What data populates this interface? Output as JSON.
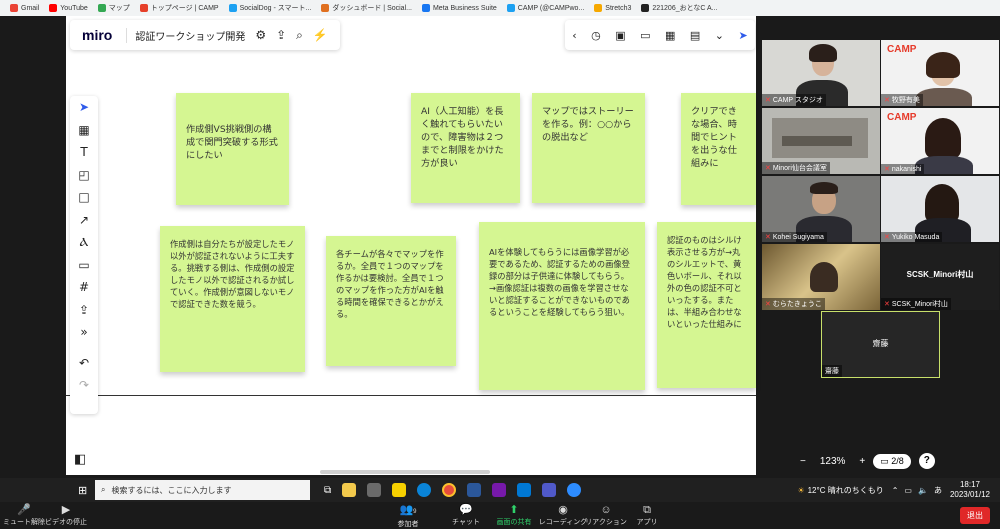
{
  "bookmarks": [
    {
      "label": "Gmail",
      "color": "#ea4335"
    },
    {
      "label": "YouTube",
      "color": "#ff0000"
    },
    {
      "label": "マップ",
      "color": "#34a853"
    },
    {
      "label": "トップページ | CAMP",
      "color": "#e6402a"
    },
    {
      "label": "SocialDog - スマート...",
      "color": "#1da1f2"
    },
    {
      "label": "ダッシュボード | Social...",
      "color": "#e07020"
    },
    {
      "label": "Meta Business Suite",
      "color": "#1877f2"
    },
    {
      "label": "CAMP (@CAMPwo...",
      "color": "#1da1f2"
    },
    {
      "label": "Stretch3",
      "color": "#f6a800"
    },
    {
      "label": "221206_おとなC A...",
      "color": "#222222"
    }
  ],
  "miro": {
    "logo": "miro",
    "board_name": "認証ワークショップ開発",
    "zoom_level": "123%",
    "page_indicator": "2/8",
    "help": "?"
  },
  "notes": [
    {
      "text": "作成側VS挑戦側の構成で関門突破する形式にしたい"
    },
    {
      "text": "AI（人工知能）を長く触れてもらいたいので、障害物は２つまでと制限をかけた方が良い"
    },
    {
      "text": "マップではストーリーを作る。例：○○からの脱出など"
    },
    {
      "text": "クリアできな場合、時間でヒントを出うな仕組みに"
    },
    {
      "text": "作成側は自分たちが設定したモノ以外が認証されないように工夫する。挑戦する側は、作成側の設定したモノ以外で認証されるか試していく。作成側が意図しないモノで認証できた数を競う。"
    },
    {
      "text": "各チームが各々でマップを作るか。全員で１つのマップを作るかは要検討。全員で１つのマップを作った方がAIを触る時間を確保できるとかがえる。"
    },
    {
      "text": "AIを体験してもらうには画像学習が必要であるため、認証するための画像登録の部分は子供達に体験してもらう。→画像認証は複数の画像を学習させないと認証することができないものであるということを経験してもらう狙い。"
    },
    {
      "text": "認証のものはシルけ表示させる方が→丸のシルエットで、黄色いボール、それ以外の色の認証不可といったする。または、半組み合わせないといった仕組みに"
    }
  ],
  "participants": [
    {
      "name": "CAMP スタジオ"
    },
    {
      "name": "牧野有美"
    },
    {
      "name": "Minori仙台会議室"
    },
    {
      "name": "nakanishi"
    },
    {
      "name": "Kohei Sugiyama"
    },
    {
      "name": "Yukiko Masuda"
    },
    {
      "name": "むらたきょうこ"
    },
    {
      "name": "SCSK_Minori村山",
      "center": "SCSK_Minori村山"
    },
    {
      "name": "齋藤",
      "center": "齋藤"
    }
  ],
  "camp_logo": "CAMP",
  "taskbar": {
    "search_placeholder": "検索するには、ここに入力します",
    "weather": "12°C 晴れのちくもり",
    "time": "18:17",
    "date": "2023/01/12",
    "ime": "あ"
  },
  "zoom_controls": {
    "mute": "ミュート解除",
    "video": "ビデオの停止",
    "participants": "参加者",
    "participants_count": "9",
    "chat": "チャット",
    "share": "画面の共有",
    "record": "レコーディング",
    "reactions": "リアクション",
    "apps": "アプリ",
    "leave": "退出"
  }
}
